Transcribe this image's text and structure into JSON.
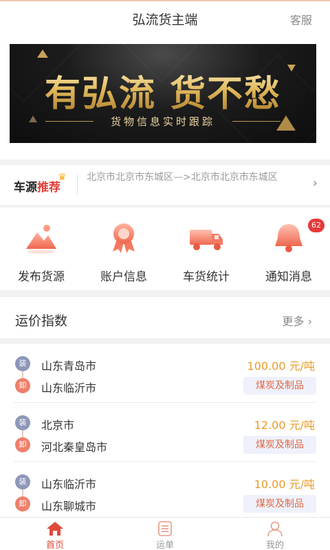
{
  "header": {
    "title": "弘流货主端",
    "service_label": "客服"
  },
  "banner": {
    "headline": "有弘流 货不愁",
    "subline": "货物信息实时跟踪"
  },
  "car_source": {
    "tag_prefix": "车源",
    "tag_highlight": "推荐",
    "route_text": "北京市北京市东城区—>北京市北京市东城区"
  },
  "shortcuts": [
    {
      "label": "发布货源",
      "icon": "mountain-icon"
    },
    {
      "label": "账户信息",
      "icon": "award-ribbon-icon"
    },
    {
      "label": "车货统计",
      "icon": "truck-icon"
    },
    {
      "label": "通知消息",
      "icon": "bell-icon",
      "badge": "62"
    }
  ],
  "freight_index": {
    "title": "运价指数",
    "more_label": "更多"
  },
  "routes": [
    {
      "load_tag": "装",
      "unload_tag": "卸",
      "from": "山东青岛市",
      "to": "山东临沂市",
      "price": "100.00 元/吨",
      "cargo": "煤炭及制品"
    },
    {
      "load_tag": "装",
      "unload_tag": "卸",
      "from": "北京市",
      "to": "河北秦皇岛市",
      "price": "12.00 元/吨",
      "cargo": "煤炭及制品"
    },
    {
      "load_tag": "装",
      "unload_tag": "卸",
      "from": "山东临沂市",
      "to": "山东聊城市",
      "price": "10.00 元/吨",
      "cargo": "煤炭及制品"
    }
  ],
  "tabbar": [
    {
      "label": "首页",
      "icon": "home-icon",
      "active": true
    },
    {
      "label": "运单",
      "icon": "waybill-icon",
      "active": false
    },
    {
      "label": "我的",
      "icon": "profile-icon",
      "active": false
    }
  ],
  "colors": {
    "accent": "#e14a3a",
    "price": "#e79b2a",
    "load_tag": "#8d97b8",
    "unload_tag": "#ef7f6a"
  }
}
